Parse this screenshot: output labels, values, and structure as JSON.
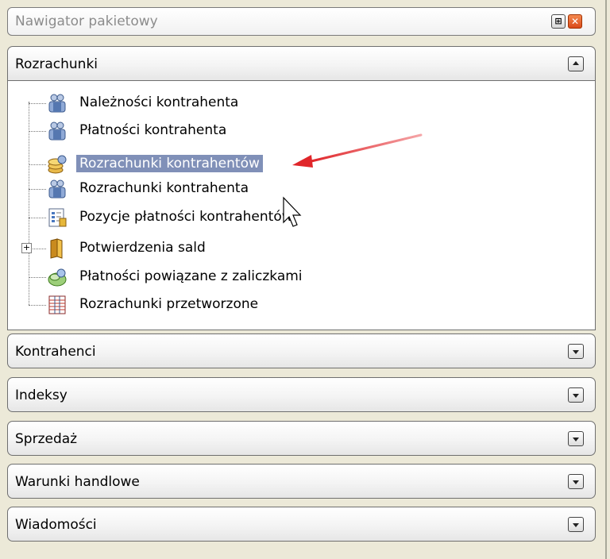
{
  "panel": {
    "title": "Nawigator pakietowy",
    "pin_glyph": "⊞",
    "close_glyph": "✕"
  },
  "sections": [
    {
      "label": "Rozrachunki",
      "expanded": true
    },
    {
      "label": "Kontrahenci",
      "expanded": false
    },
    {
      "label": "Indeksy",
      "expanded": false
    },
    {
      "label": "Sprzedaż",
      "expanded": false
    },
    {
      "label": "Warunki handlowe",
      "expanded": false
    },
    {
      "label": "Wiadomości",
      "expanded": false
    }
  ],
  "tree": {
    "items": [
      {
        "label": "Należności kontrahenta",
        "icon": "users-icon"
      },
      {
        "label": "Płatności kontrahenta",
        "icon": "users-icon"
      },
      {
        "label": "Rozrachunki kontrahentów",
        "icon": "coins-icon",
        "selected": true
      },
      {
        "label": "Rozrachunki kontrahenta",
        "icon": "users-icon"
      },
      {
        "label": "Pozycje płatności kontrahentów",
        "icon": "document-list-icon"
      },
      {
        "label": "Potwierdzenia sald",
        "icon": "folder-icon",
        "expandable": true,
        "expander_glyph": "+"
      },
      {
        "label": "Płatności powiązane z zaliczkami",
        "icon": "linked-payments-icon"
      },
      {
        "label": "Rozrachunki przetworzone",
        "icon": "ledger-icon"
      }
    ]
  },
  "colors": {
    "selection": "#8090b8",
    "arrow": "#e0262a"
  }
}
